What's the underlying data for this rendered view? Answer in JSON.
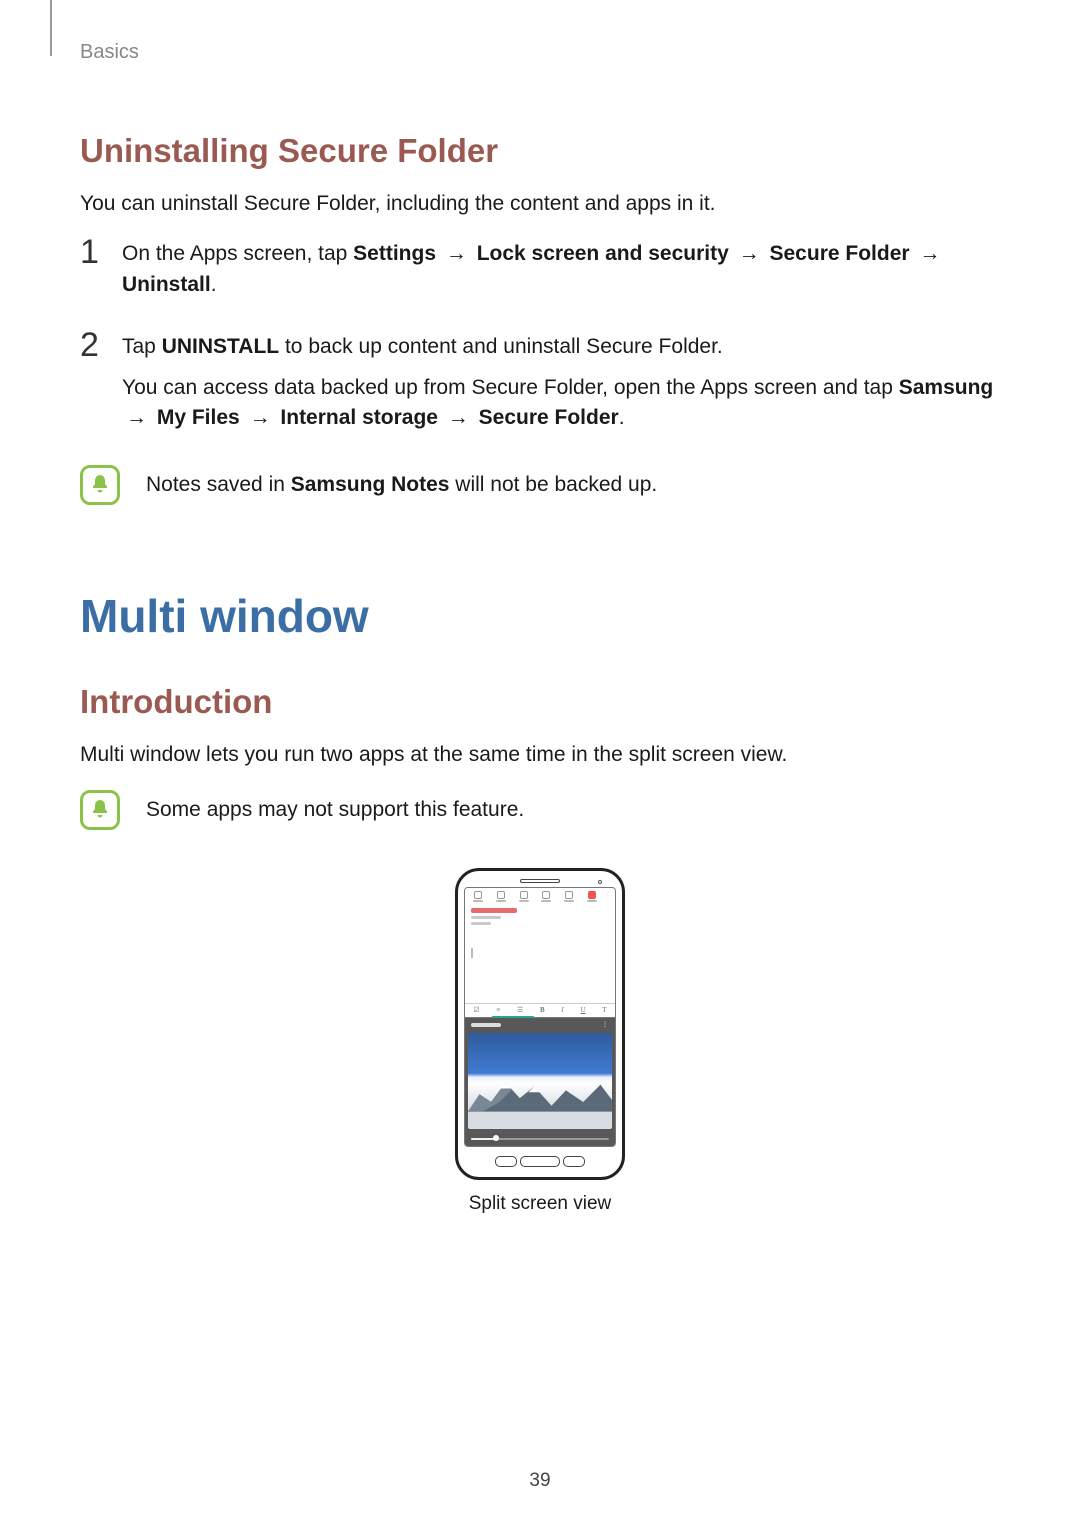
{
  "running_head": "Basics",
  "uninstall": {
    "heading": "Uninstalling Secure Folder",
    "intro": "You can uninstall Secure Folder, including the content and apps in it.",
    "step1_num": "1",
    "step1_lead": "On the Apps screen, tap ",
    "step1_path": {
      "a": "Settings",
      "b": "Lock screen and security",
      "c": "Secure Folder",
      "d": "Uninstall"
    },
    "step1_period": ".",
    "step2_num": "2",
    "step2_line1_a": "Tap ",
    "step2_line1_b": "UNINSTALL",
    "step2_line1_c": " to back up content and uninstall Secure Folder.",
    "step2_line2_a": "You can access data backed up from Secure Folder, open the Apps screen and tap ",
    "step2_path": {
      "a": "Samsung",
      "b": "My Files",
      "c": "Internal storage",
      "d": "Secure Folder"
    },
    "step2_period": ".",
    "note_a": "Notes saved in ",
    "note_b": "Samsung Notes",
    "note_c": " will not be backed up."
  },
  "arrow": "→",
  "multiwindow": {
    "heading": "Multi window",
    "intro_heading": "Introduction",
    "intro_text": "Multi window lets you run two apps at the same time in the split screen view.",
    "note": "Some apps may not support this feature.",
    "caption": "Split screen view",
    "fmt": {
      "b": "B",
      "i": "I",
      "u": "U",
      "t": "T"
    }
  },
  "page_number": "39"
}
